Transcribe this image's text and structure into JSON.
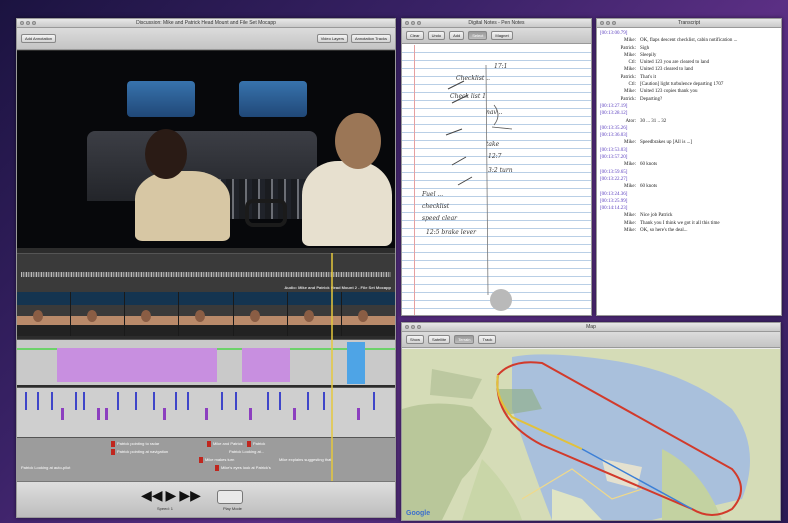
{
  "main_window": {
    "title": "Discussion: Mike and Patrick Head Mount and File Set Mocapp",
    "toolbar_left": "Add Annotation",
    "toolbar_right": [
      "Video Layers",
      "Annotation Tracks"
    ],
    "audio_label": "Audio: Mike and Patrick Head Mount 2 - File Set Mocapp",
    "annotations": [
      "Patrick pointing to radar",
      "Patrick pointing at navigation",
      "Mike and Patrick",
      "Patrick ",
      "Patrick Looking at...",
      "Mike makes turn",
      "Patrick Looking at auto-pilot",
      "Mike's eyes look at Patrick's",
      "Mike explains suggesting that"
    ],
    "transport_labels": [
      "Speed: 1",
      "Play Mode"
    ]
  },
  "notes_window": {
    "title": "Digital Notes - Pen Notes",
    "tools": [
      "Clear",
      "Undo",
      "Add",
      "Select",
      "Magnet"
    ],
    "handwriting": [
      "17:1",
      "Checklist ..",
      "Check list 1",
      "nav ..",
      "take",
      "12:7",
      "3:2 turn",
      "Fuel ...",
      "checklist ",
      "speed clear",
      "12:5 brake lever"
    ]
  },
  "transcript_window": {
    "title": "Transcript",
    "rows": [
      {
        "ts": "[00:13:00.79]",
        "spk": "",
        "text": ""
      },
      {
        "ts": "",
        "spk": "Mike:",
        "text": "OK, flaps descent checklist, cabin notification ..."
      },
      {
        "ts": "",
        "spk": "Patrick:",
        "text": "Sigh"
      },
      {
        "ts": "",
        "spk": "Mike:",
        "text": "Sleepily"
      },
      {
        "ts": "",
        "spk": "Ctl:",
        "text": "United 123 you are cleared to land"
      },
      {
        "ts": "",
        "spk": "Mike:",
        "text": "United 123 cleared to land"
      },
      {
        "ts": "",
        "spk": "Patrick:",
        "text": "That's it"
      },
      {
        "ts": "",
        "spk": "Ctl:",
        "text": "[Caution] light turbulence departing 1707"
      },
      {
        "ts": "",
        "spk": "Mike:",
        "text": "United 123 copies thank you"
      },
      {
        "ts": "",
        "spk": "Patrick:",
        "text": "Departing?"
      },
      {
        "ts": "[00:13:27.19]",
        "spk": "",
        "text": ""
      },
      {
        "ts": "[00:13:28.12]",
        "spk": "",
        "text": ""
      },
      {
        "ts": "",
        "spk": "Ator:",
        "text": "30 ... 31 .. 32"
      },
      {
        "ts": "[00:13:35.26]",
        "spk": "",
        "text": ""
      },
      {
        "ts": "[00:13:36.03]",
        "spk": "",
        "text": ""
      },
      {
        "ts": "",
        "spk": "Mike:",
        "text": "Speedbrakes up [All is ...]"
      },
      {
        "ts": "[00:13:53.03]",
        "spk": "",
        "text": ""
      },
      {
        "ts": "[00:13:57.20]",
        "spk": "",
        "text": ""
      },
      {
        "ts": "",
        "spk": "Mike:",
        "text": "60 knots"
      },
      {
        "ts": "[00:13:59.65]",
        "spk": "",
        "text": ""
      },
      {
        "ts": "[00:13:22.27]",
        "spk": "",
        "text": ""
      },
      {
        "ts": "",
        "spk": "Mike:",
        "text": "60 knots"
      },
      {
        "ts": "[00:13:24.36]",
        "spk": "",
        "text": ""
      },
      {
        "ts": "[00:13:25.99]",
        "spk": "",
        "text": ""
      },
      {
        "ts": "[00:14:14.23]",
        "spk": "",
        "text": ""
      },
      {
        "ts": "",
        "spk": "Mike:",
        "text": "Nice job Patrick"
      },
      {
        "ts": "",
        "spk": "Mike:",
        "text": "Thank you I think we got it all this time"
      },
      {
        "ts": "",
        "spk": "Mike:",
        "text": "OK, so here's the deal..."
      }
    ]
  },
  "map_window": {
    "title": "Map",
    "tabs": [
      "Show",
      "Satellite",
      "Terrain",
      "Track"
    ],
    "active_tab": "Terrain",
    "logo": "Google"
  }
}
